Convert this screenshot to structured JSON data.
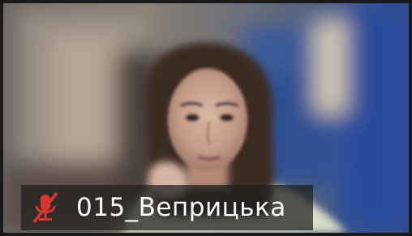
{
  "participant": {
    "name": "015_Веприцька",
    "mic_status_icon": "mic-muted-icon",
    "mic_status_color": "#d7372f"
  }
}
